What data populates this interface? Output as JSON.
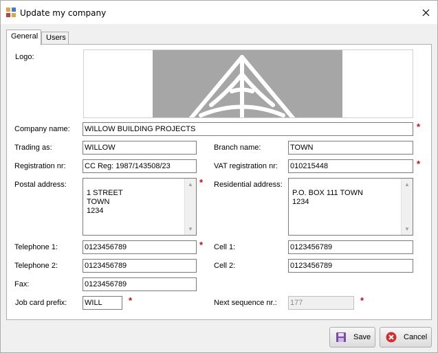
{
  "window": {
    "title": "Update my company"
  },
  "tabs": [
    {
      "label": "General",
      "active": true
    },
    {
      "label": "Users",
      "active": false
    }
  ],
  "form": {
    "logo_label": "Logo:",
    "company_name": {
      "label": "Company name:",
      "value": "WILLOW BUILDING PROJECTS",
      "required": true
    },
    "trading_as": {
      "label": "Trading as:",
      "value": "WILLOW"
    },
    "branch_name": {
      "label": "Branch name:",
      "value": "TOWN"
    },
    "registration_nr": {
      "label": "Registration nr:",
      "value": "CC Reg: 1987/143508/23"
    },
    "vat_registration_nr": {
      "label": "VAT registration nr:",
      "value": "010215448",
      "required": true
    },
    "postal_address": {
      "label": "Postal address:",
      "value": "1 STREET\nTOWN\n1234",
      "required": true
    },
    "residential_address": {
      "label": "Residential address:",
      "value": "P.O. BOX 111 TOWN\n1234"
    },
    "telephone_1": {
      "label": "Telephone 1:",
      "value": "0123456789",
      "required": true
    },
    "cell_1": {
      "label": "Cell 1:",
      "value": "0123456789"
    },
    "telephone_2": {
      "label": "Telephone 2:",
      "value": "0123456789"
    },
    "cell_2": {
      "label": "Cell 2:",
      "value": "0123456789"
    },
    "fax": {
      "label": "Fax:",
      "value": "0123456789"
    },
    "job_card_prefix": {
      "label": "Job card prefix:",
      "value": "WILL",
      "required": true
    },
    "next_sequence_nr": {
      "label": "Next sequence nr.:",
      "value": "177",
      "required": true,
      "disabled": true
    }
  },
  "buttons": {
    "save": {
      "label": "Save",
      "icon": "floppy-disk-icon"
    },
    "cancel": {
      "label": "Cancel",
      "icon": "cancel-x-icon"
    }
  },
  "colors": {
    "required": "#dd0000",
    "cancel_icon": "#d92b2b",
    "save_icon": "#7b4aa8",
    "logo_bg": "#a6a6a6"
  }
}
